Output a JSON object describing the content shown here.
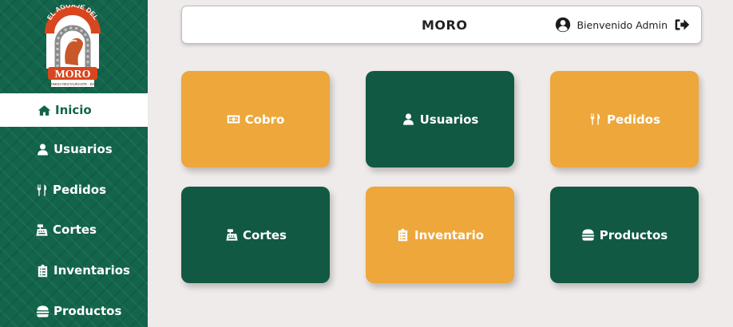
{
  "brand": {
    "logo_arc_text": "EL AGUAJE DEL",
    "logo_name": "MORO",
    "logo_sub": "COMIDA RESTAURANTE · BAR"
  },
  "sidebar": {
    "items": [
      {
        "label": "Inicio",
        "icon": "home-icon",
        "active": true
      },
      {
        "label": "Usuarios",
        "icon": "user-icon",
        "active": false
      },
      {
        "label": "Pedidos",
        "icon": "utensils-icon",
        "active": false
      },
      {
        "label": "Cortes",
        "icon": "cash-register-icon",
        "active": false
      },
      {
        "label": "Inventarios",
        "icon": "clipboard-list-icon",
        "active": false
      },
      {
        "label": "Productos",
        "icon": "burger-icon",
        "active": false
      }
    ]
  },
  "header": {
    "title": "MORO",
    "welcome": "Bienvenido Admin",
    "user_icon": "user-circle-icon",
    "logout_icon": "sign-out-icon"
  },
  "cards": [
    {
      "label": "Cobro",
      "icon": "money-bill-icon",
      "color": "#eda73a"
    },
    {
      "label": "Usuarios",
      "icon": "user-icon",
      "color": "#115943"
    },
    {
      "label": "Pedidos",
      "icon": "utensils-icon",
      "color": "#eda73a"
    },
    {
      "label": "Cortes",
      "icon": "cash-register-icon",
      "color": "#115943"
    },
    {
      "label": "Inventario",
      "icon": "clipboard-list-icon",
      "color": "#eda73a"
    },
    {
      "label": "Productos",
      "icon": "burger-icon",
      "color": "#115943"
    }
  ],
  "colors": {
    "sidebar": "#12644a",
    "orange": "#eda73a",
    "green": "#115943",
    "background": "#f0ebeb"
  }
}
